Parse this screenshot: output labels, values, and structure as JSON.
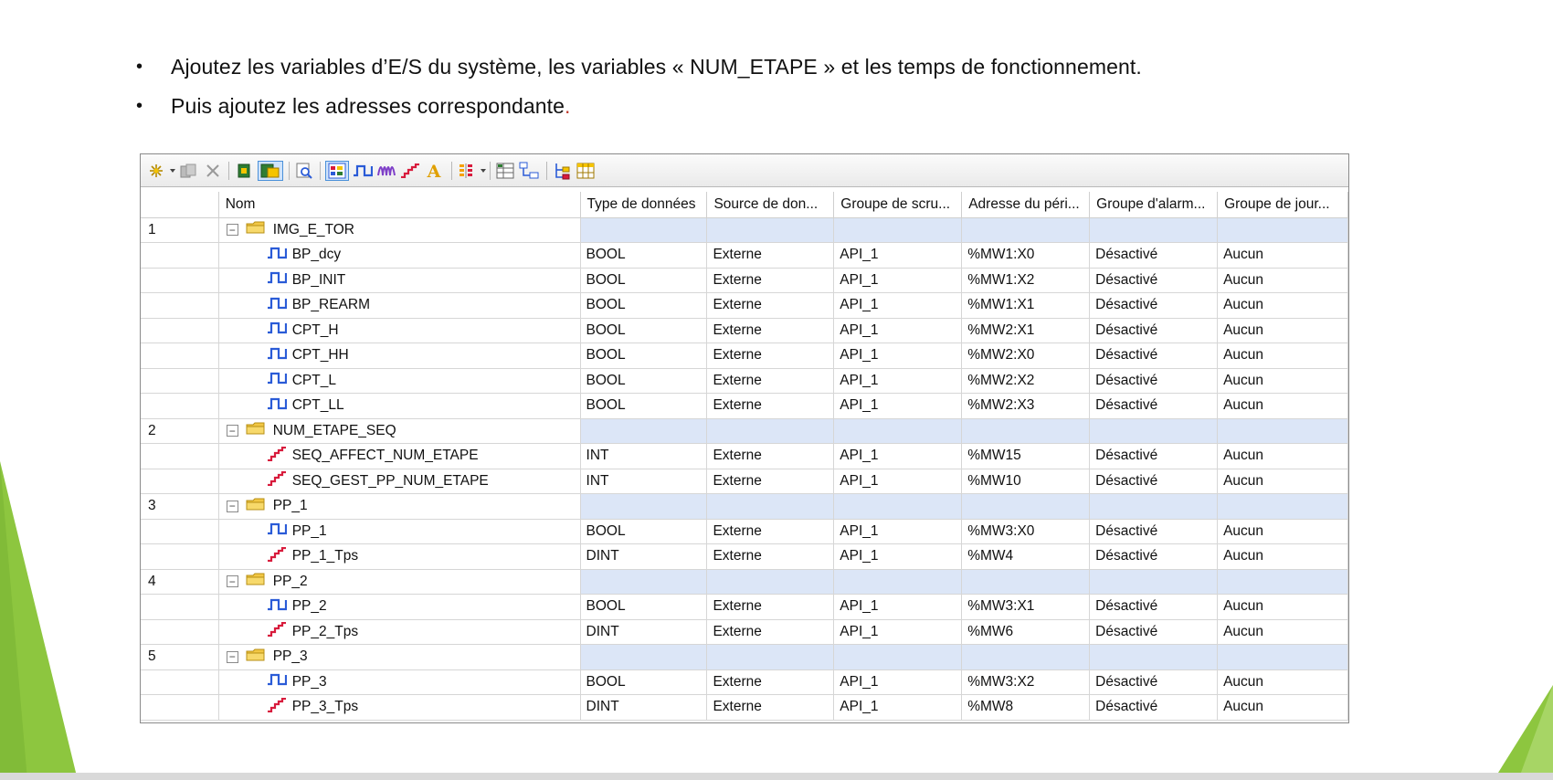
{
  "bullets": [
    "Ajoutez les variables d’E/S du système, les variables « NUM_ETAPE » et les temps de fonctionnement.",
    "Puis ajoutez les adresses correspondante"
  ],
  "bullet_symbol": "•",
  "bullet2_tail": ".",
  "colors": {
    "accent_green": "#8dc63f",
    "group_row": "#dce6f7",
    "bool_icon": "#2a5bd7",
    "int_icon": "#d81b3c"
  },
  "table": {
    "headers": [
      "",
      "Nom",
      "Type de données",
      "Source de don...",
      "Groupe de scru...",
      "Adresse du péri...",
      "Groupe d'alarm...",
      "Groupe de jour..."
    ],
    "rows": [
      {
        "kind": "group",
        "index": "1",
        "name": "IMG_E_TOR"
      },
      {
        "kind": "var",
        "icon": "bool-signal-icon",
        "name": "BP_dcy",
        "type": "BOOL",
        "source": "Externe",
        "scan": "API_1",
        "address": "%MW1:X0",
        "alarm": "Désactivé",
        "log": "Aucun"
      },
      {
        "kind": "var",
        "icon": "bool-signal-icon",
        "name": "BP_INIT",
        "type": "BOOL",
        "source": "Externe",
        "scan": "API_1",
        "address": "%MW1:X2",
        "alarm": "Désactivé",
        "log": "Aucun"
      },
      {
        "kind": "var",
        "icon": "bool-signal-icon",
        "name": "BP_REARM",
        "type": "BOOL",
        "source": "Externe",
        "scan": "API_1",
        "address": "%MW1:X1",
        "alarm": "Désactivé",
        "log": "Aucun"
      },
      {
        "kind": "var",
        "icon": "bool-signal-icon",
        "name": "CPT_H",
        "type": "BOOL",
        "source": "Externe",
        "scan": "API_1",
        "address": "%MW2:X1",
        "alarm": "Désactivé",
        "log": "Aucun"
      },
      {
        "kind": "var",
        "icon": "bool-signal-icon",
        "name": "CPT_HH",
        "type": "BOOL",
        "source": "Externe",
        "scan": "API_1",
        "address": "%MW2:X0",
        "alarm": "Désactivé",
        "log": "Aucun"
      },
      {
        "kind": "var",
        "icon": "bool-signal-icon",
        "name": "CPT_L",
        "type": "BOOL",
        "source": "Externe",
        "scan": "API_1",
        "address": "%MW2:X2",
        "alarm": "Désactivé",
        "log": "Aucun"
      },
      {
        "kind": "var",
        "icon": "bool-signal-icon",
        "name": "CPT_LL",
        "type": "BOOL",
        "source": "Externe",
        "scan": "API_1",
        "address": "%MW2:X3",
        "alarm": "Désactivé",
        "log": "Aucun"
      },
      {
        "kind": "group",
        "index": "2",
        "name": "NUM_ETAPE_SEQ"
      },
      {
        "kind": "var",
        "icon": "int-stair-icon",
        "name": "SEQ_AFFECT_NUM_ETAPE",
        "type": "INT",
        "source": "Externe",
        "scan": "API_1",
        "address": "%MW15",
        "alarm": "Désactivé",
        "log": "Aucun"
      },
      {
        "kind": "var",
        "icon": "int-stair-icon",
        "name": "SEQ_GEST_PP_NUM_ETAPE",
        "type": "INT",
        "source": "Externe",
        "scan": "API_1",
        "address": "%MW10",
        "alarm": "Désactivé",
        "log": "Aucun"
      },
      {
        "kind": "group",
        "index": "3",
        "name": "PP_1"
      },
      {
        "kind": "var",
        "icon": "bool-signal-icon",
        "name": "PP_1",
        "type": "BOOL",
        "source": "Externe",
        "scan": "API_1",
        "address": "%MW3:X0",
        "alarm": "Désactivé",
        "log": "Aucun"
      },
      {
        "kind": "var",
        "icon": "int-stair-icon",
        "name": "PP_1_Tps",
        "type": "DINT",
        "source": "Externe",
        "scan": "API_1",
        "address": "%MW4",
        "alarm": "Désactivé",
        "log": "Aucun"
      },
      {
        "kind": "group",
        "index": "4",
        "name": "PP_2"
      },
      {
        "kind": "var",
        "icon": "bool-signal-icon",
        "name": "PP_2",
        "type": "BOOL",
        "source": "Externe",
        "scan": "API_1",
        "address": "%MW3:X1",
        "alarm": "Désactivé",
        "log": "Aucun"
      },
      {
        "kind": "var",
        "icon": "int-stair-icon",
        "name": "PP_2_Tps",
        "type": "DINT",
        "source": "Externe",
        "scan": "API_1",
        "address": "%MW6",
        "alarm": "Désactivé",
        "log": "Aucun"
      },
      {
        "kind": "group",
        "index": "5",
        "name": "PP_3"
      },
      {
        "kind": "var",
        "icon": "bool-signal-icon",
        "name": "PP_3",
        "type": "BOOL",
        "source": "Externe",
        "scan": "API_1",
        "address": "%MW3:X2",
        "alarm": "Désactivé",
        "log": "Aucun"
      },
      {
        "kind": "var",
        "icon": "int-stair-icon",
        "name": "PP_3_Tps",
        "type": "DINT",
        "source": "Externe",
        "scan": "API_1",
        "address": "%MW8",
        "alarm": "Désactivé",
        "log": "Aucun"
      }
    ]
  }
}
